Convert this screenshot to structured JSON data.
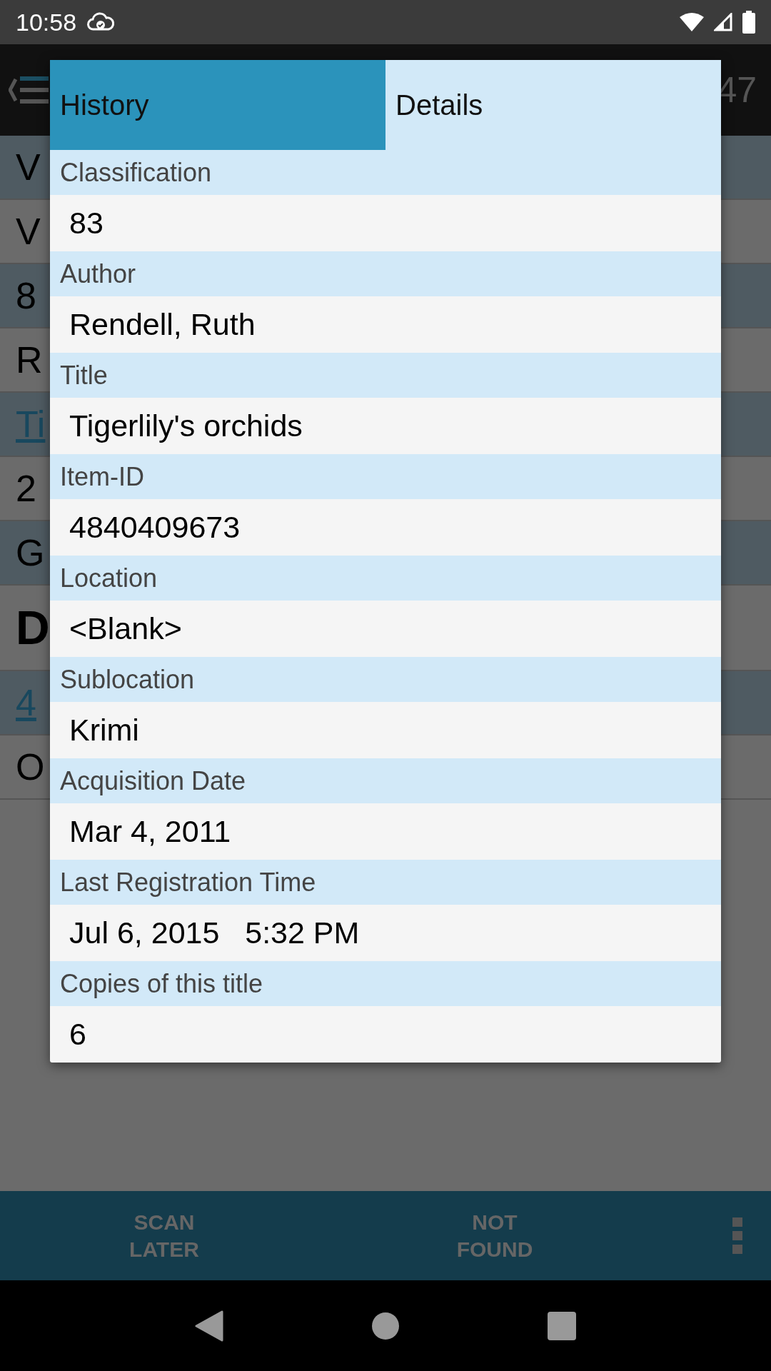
{
  "status_bar": {
    "time": "10:58"
  },
  "toolbar": {
    "count": "47"
  },
  "background_rows": [
    {
      "text": "V",
      "kind": "plain"
    },
    {
      "text": "V",
      "kind": "plain"
    },
    {
      "text": "8",
      "kind": "plain"
    },
    {
      "text": "R",
      "kind": "plain"
    },
    {
      "text": "Ti",
      "kind": "link"
    },
    {
      "text": "2",
      "kind": "plain"
    },
    {
      "text": "G",
      "kind": "plain"
    },
    {
      "text": "D",
      "kind": "heading"
    },
    {
      "text": "4",
      "kind": "link"
    },
    {
      "text": "O",
      "kind": "plain"
    }
  ],
  "dialog": {
    "tabs": [
      {
        "label": "History",
        "selected": true
      },
      {
        "label": "Details",
        "selected": false
      }
    ],
    "fields": [
      {
        "label": "Classification",
        "value": "83"
      },
      {
        "label": "Author",
        "value": "Rendell, Ruth"
      },
      {
        "label": "Title",
        "value": "Tigerlily's orchids"
      },
      {
        "label": "Item-ID",
        "value": "4840409673"
      },
      {
        "label": "Location",
        "value": "<Blank>"
      },
      {
        "label": "Sublocation",
        "value": "Krimi"
      },
      {
        "label": "Acquisition Date",
        "value": "Mar 4, 2011"
      },
      {
        "label": "Last Registration Time",
        "value": "Jul 6, 2015   5:32 PM"
      },
      {
        "label": "Copies of this title",
        "value": "6"
      }
    ]
  },
  "bottom_bar": {
    "buttons": [
      "SCAN LATER",
      "NOT FOUND"
    ]
  }
}
